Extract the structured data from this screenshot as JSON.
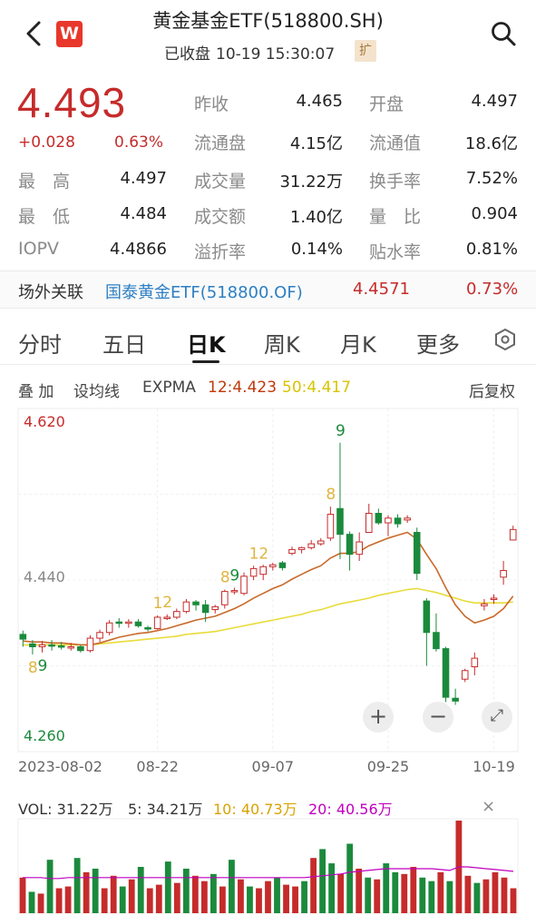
{
  "header": {
    "title": "黄金基金ETF(518800.SH)",
    "status": "已收盘",
    "datetime": "10-19 15:30:07",
    "badge": "扩",
    "logo_text": "W",
    "icons": {
      "back": "back-arrow-icon",
      "search": "search-icon"
    }
  },
  "quote": {
    "price": "4.493",
    "change": "+0.028",
    "change_pct": "0.63%",
    "rows": [
      [
        {
          "label": "最　高",
          "value": "4.497"
        },
        {
          "label": "成交量",
          "value": "31.22万"
        },
        {
          "label": "换手率",
          "value": "7.52%"
        }
      ],
      [
        {
          "label": "最　低",
          "value": "4.484"
        },
        {
          "label": "成交额",
          "value": "1.40亿"
        },
        {
          "label": "量　比",
          "value": "0.904"
        }
      ],
      [
        {
          "label": "IOPV",
          "value": "4.4866"
        },
        {
          "label": "溢折率",
          "value": "0.14%"
        },
        {
          "label": "贴水率",
          "value": "0.81%"
        }
      ]
    ],
    "top": [
      [
        {
          "label": "昨收",
          "value": "4.465"
        },
        {
          "label": "开盘",
          "value": "4.497"
        }
      ],
      [
        {
          "label": "流通盘",
          "value": "4.15亿"
        },
        {
          "label": "流通值",
          "value": "18.6亿"
        }
      ]
    ],
    "colors": {
      "up": "#c62b2b",
      "down": "#1b8a3c"
    }
  },
  "otc": {
    "label": "场外关联",
    "name": "国泰黄金ETF(518800.OF)",
    "price": "4.4571",
    "change_pct": "0.73%"
  },
  "tabs": [
    "分时",
    "五日",
    "日K",
    "周K",
    "月K",
    "更多"
  ],
  "active_tab": "日K",
  "toolbar": {
    "overlay": "叠 加",
    "ma_setting": "设均线",
    "indicator": "EXPMA",
    "ema12": "12:4.423",
    "ema50": "50:4.417",
    "adjust": "后复权"
  },
  "volume": {
    "label": "VOL: 31.22万",
    "ma5": "5: 34.21万",
    "ma10": "10: 40.73万",
    "ma20": "20: 40.56万"
  },
  "chart_data": {
    "type": "candlestick",
    "y_ticks": [
      "4.620",
      "4.440",
      "4.260"
    ],
    "ylim": [
      4.26,
      4.62
    ],
    "x_ticks": [
      {
        "label": "2023-08-02",
        "index": 0
      },
      {
        "label": "08-22",
        "index": 14
      },
      {
        "label": "09-07",
        "index": 26
      },
      {
        "label": "09-25",
        "index": 38
      },
      {
        "label": "10-19",
        "index": 49
      }
    ],
    "candles": [
      {
        "o": 4.383,
        "h": 4.387,
        "l": 4.37,
        "c": 4.378
      },
      {
        "o": 4.373,
        "h": 4.377,
        "l": 4.362,
        "c": 4.37
      },
      {
        "o": 4.37,
        "h": 4.376,
        "l": 4.364,
        "c": 4.372
      },
      {
        "o": 4.372,
        "h": 4.377,
        "l": 4.366,
        "c": 4.371
      },
      {
        "o": 4.371,
        "h": 4.375,
        "l": 4.367,
        "c": 4.37
      },
      {
        "o": 4.369,
        "h": 4.374,
        "l": 4.366,
        "c": 4.37
      },
      {
        "o": 4.37,
        "h": 4.372,
        "l": 4.364,
        "c": 4.366
      },
      {
        "o": 4.366,
        "h": 4.382,
        "l": 4.364,
        "c": 4.379
      },
      {
        "o": 4.379,
        "h": 4.388,
        "l": 4.375,
        "c": 4.385
      },
      {
        "o": 4.385,
        "h": 4.398,
        "l": 4.382,
        "c": 4.395
      },
      {
        "o": 4.396,
        "h": 4.4,
        "l": 4.39,
        "c": 4.395
      },
      {
        "o": 4.395,
        "h": 4.399,
        "l": 4.39,
        "c": 4.396
      },
      {
        "o": 4.396,
        "h": 4.399,
        "l": 4.39,
        "c": 4.392
      },
      {
        "o": 4.39,
        "h": 4.392,
        "l": 4.386,
        "c": 4.389
      },
      {
        "o": 4.389,
        "h": 4.403,
        "l": 4.388,
        "c": 4.401
      },
      {
        "o": 4.401,
        "h": 4.404,
        "l": 4.398,
        "c": 4.401
      },
      {
        "o": 4.401,
        "h": 4.41,
        "l": 4.399,
        "c": 4.407
      },
      {
        "o": 4.407,
        "h": 4.42,
        "l": 4.405,
        "c": 4.417
      },
      {
        "o": 4.417,
        "h": 4.419,
        "l": 4.408,
        "c": 4.414
      },
      {
        "o": 4.414,
        "h": 4.419,
        "l": 4.396,
        "c": 4.406
      },
      {
        "o": 4.409,
        "h": 4.414,
        "l": 4.405,
        "c": 4.412
      },
      {
        "o": 4.414,
        "h": 4.43,
        "l": 4.41,
        "c": 4.428
      },
      {
        "o": 4.428,
        "h": 4.432,
        "l": 4.425,
        "c": 4.429
      },
      {
        "o": 4.426,
        "h": 4.448,
        "l": 4.424,
        "c": 4.444
      },
      {
        "o": 4.444,
        "h": 4.455,
        "l": 4.44,
        "c": 4.452
      },
      {
        "o": 4.446,
        "h": 4.456,
        "l": 4.44,
        "c": 4.454
      },
      {
        "o": 4.454,
        "h": 4.458,
        "l": 4.45,
        "c": 4.456
      },
      {
        "o": 4.458,
        "h": 4.46,
        "l": 4.45,
        "c": 4.453
      },
      {
        "o": 4.468,
        "h": 4.475,
        "l": 4.466,
        "c": 4.472
      },
      {
        "o": 4.472,
        "h": 4.475,
        "l": 4.468,
        "c": 4.474
      },
      {
        "o": 4.474,
        "h": 4.482,
        "l": 4.472,
        "c": 4.478
      },
      {
        "o": 4.478,
        "h": 4.484,
        "l": 4.476,
        "c": 4.481
      },
      {
        "o": 4.484,
        "h": 4.517,
        "l": 4.481,
        "c": 4.509
      },
      {
        "o": 4.515,
        "h": 4.584,
        "l": 4.462,
        "c": 4.488
      },
      {
        "o": 4.488,
        "h": 4.491,
        "l": 4.45,
        "c": 4.467
      },
      {
        "o": 4.467,
        "h": 4.49,
        "l": 4.46,
        "c": 4.48
      },
      {
        "o": 4.49,
        "h": 4.52,
        "l": 4.49,
        "c": 4.51
      },
      {
        "o": 4.51,
        "h": 4.515,
        "l": 4.498,
        "c": 4.5
      },
      {
        "o": 4.5,
        "h": 4.508,
        "l": 4.486,
        "c": 4.505
      },
      {
        "o": 4.505,
        "h": 4.509,
        "l": 4.495,
        "c": 4.499
      },
      {
        "o": 4.503,
        "h": 4.508,
        "l": 4.5,
        "c": 4.505
      },
      {
        "o": 4.49,
        "h": 4.495,
        "l": 4.44,
        "c": 4.447
      },
      {
        "o": 4.418,
        "h": 4.421,
        "l": 4.35,
        "c": 4.385
      },
      {
        "o": 4.385,
        "h": 4.405,
        "l": 4.365,
        "c": 4.368
      },
      {
        "o": 4.368,
        "h": 4.37,
        "l": 4.312,
        "c": 4.317
      },
      {
        "o": 4.316,
        "h": 4.326,
        "l": 4.309,
        "c": 4.313
      },
      {
        "o": 4.336,
        "h": 4.347,
        "l": 4.333,
        "c": 4.345
      },
      {
        "o": 4.349,
        "h": 4.364,
        "l": 4.34,
        "c": 4.358
      },
      {
        "o": 4.413,
        "h": 4.42,
        "l": 4.408,
        "c": 4.415
      },
      {
        "o": 4.42,
        "h": 4.425,
        "l": 4.415,
        "c": 4.421
      },
      {
        "o": 4.443,
        "h": 4.46,
        "l": 4.435,
        "c": 4.45
      },
      {
        "o": 4.482,
        "h": 4.497,
        "l": 4.484,
        "c": 4.493
      }
    ],
    "ema12": [
      4.376,
      4.375,
      4.375,
      4.374,
      4.374,
      4.373,
      4.372,
      4.372,
      4.374,
      4.377,
      4.38,
      4.382,
      4.384,
      4.385,
      4.387,
      4.389,
      4.392,
      4.395,
      4.398,
      4.4,
      4.402,
      4.406,
      4.41,
      4.415,
      4.421,
      4.426,
      4.431,
      4.435,
      4.441,
      4.446,
      4.451,
      4.455,
      4.463,
      4.468,
      4.468,
      4.47,
      4.476,
      4.48,
      4.484,
      4.487,
      4.49,
      4.483,
      4.467,
      4.452,
      4.432,
      4.414,
      4.402,
      4.395,
      4.398,
      4.402,
      4.41,
      4.423
    ],
    "ema50": [
      4.372,
      4.372,
      4.372,
      4.372,
      4.372,
      4.372,
      4.372,
      4.372,
      4.373,
      4.374,
      4.375,
      4.376,
      4.377,
      4.378,
      4.379,
      4.38,
      4.381,
      4.383,
      4.384,
      4.385,
      4.386,
      4.388,
      4.39,
      4.392,
      4.394,
      4.396,
      4.398,
      4.4,
      4.402,
      4.404,
      4.407,
      4.409,
      4.412,
      4.415,
      4.417,
      4.419,
      4.421,
      4.424,
      4.426,
      4.428,
      4.43,
      4.431,
      4.429,
      4.427,
      4.424,
      4.421,
      4.418,
      4.416,
      4.416,
      4.416,
      4.416,
      4.417
    ],
    "td_labels": [
      {
        "index": 1,
        "text": "8",
        "kind": "sell"
      },
      {
        "index": 2,
        "text": "9",
        "kind": "buy"
      },
      {
        "index": 14,
        "text": "1",
        "kind": "sell"
      },
      {
        "index": 15,
        "text": "2",
        "kind": "sell"
      },
      {
        "index": 21,
        "text": "8",
        "kind": "sell"
      },
      {
        "index": 22,
        "text": "9",
        "kind": "buy"
      },
      {
        "index": 24,
        "text": "12",
        "kind": "sell"
      },
      {
        "index": 32,
        "text": "8",
        "kind": "sell"
      },
      {
        "index": 33,
        "text": "9",
        "kind": "buy"
      }
    ],
    "volume_values": [
      40,
      24,
      22,
      60,
      28,
      30,
      62,
      46,
      50,
      28,
      42,
      30,
      38,
      52,
      28,
      32,
      58,
      34,
      50,
      42,
      36,
      44,
      30,
      60,
      38,
      30,
      28,
      36,
      40,
      32,
      30,
      36,
      62,
      72,
      56,
      44,
      78,
      50,
      40,
      38,
      56,
      46,
      44,
      52,
      40,
      36,
      46,
      36,
      104,
      42,
      34,
      38,
      46,
      40,
      28
    ],
    "volume_dir": [
      "u",
      "d",
      "u",
      "d",
      "u",
      "u",
      "d",
      "u",
      "d",
      "u",
      "u",
      "d",
      "u",
      "d",
      "u",
      "u",
      "d",
      "u",
      "d",
      "u",
      "u",
      "d",
      "u",
      "d",
      "u",
      "d",
      "u",
      "u",
      "d",
      "u",
      "u",
      "d",
      "u",
      "d",
      "d",
      "u",
      "d",
      "u",
      "d",
      "u",
      "d",
      "d",
      "u",
      "u",
      "d",
      "d",
      "u",
      "d",
      "u",
      "u",
      "d",
      "u",
      "u",
      "u",
      "u"
    ],
    "volume_ma": [
      40,
      40,
      40,
      39,
      39,
      40,
      40,
      40,
      40,
      40,
      40,
      40,
      40,
      40,
      40,
      40,
      40,
      40,
      40,
      40,
      40,
      40,
      40,
      40,
      40,
      40,
      40,
      40,
      40,
      40,
      40,
      40,
      41,
      42,
      43,
      44,
      46,
      47,
      48,
      49,
      50,
      50,
      50,
      50,
      50,
      50,
      49,
      48,
      52,
      52,
      51,
      50,
      49,
      48,
      47
    ]
  }
}
